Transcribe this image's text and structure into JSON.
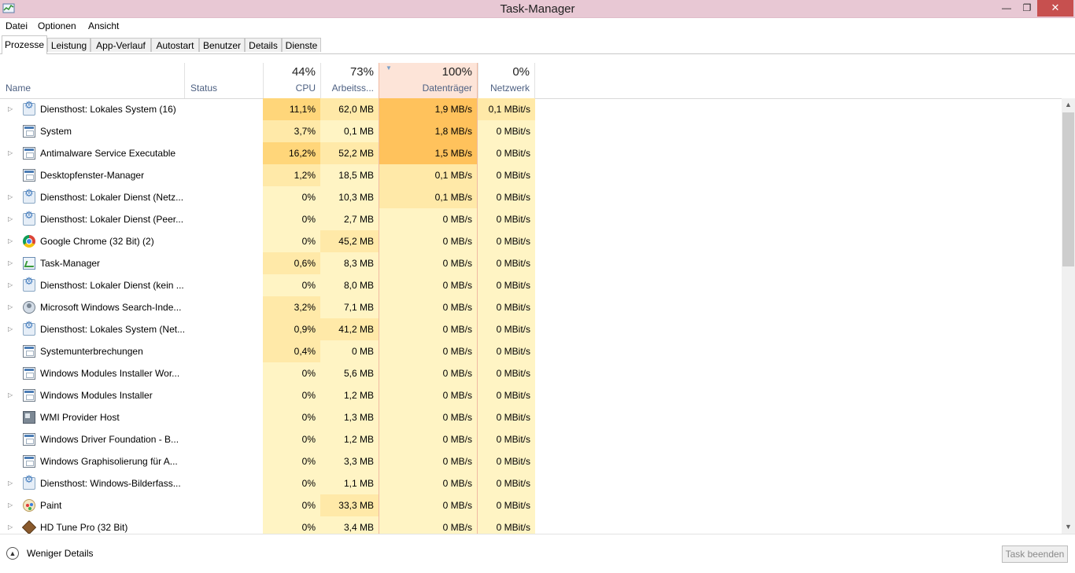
{
  "window": {
    "title": "Task-Manager",
    "minimize": "—",
    "maximize": "❐",
    "close": "✕"
  },
  "menu": [
    "Datei",
    "Optionen",
    "Ansicht"
  ],
  "tabs": [
    {
      "label": "Prozesse",
      "active": true
    },
    {
      "label": "Leistung"
    },
    {
      "label": "App-Verlauf"
    },
    {
      "label": "Autostart"
    },
    {
      "label": "Benutzer"
    },
    {
      "label": "Details"
    },
    {
      "label": "Dienste"
    }
  ],
  "columns": {
    "name": "Name",
    "status": "Status",
    "cpu": {
      "pct": "44%",
      "label": "CPU"
    },
    "mem": {
      "pct": "73%",
      "label": "Arbeitss..."
    },
    "disk": {
      "pct": "100%",
      "label": "Datenträger"
    },
    "net": {
      "pct": "0%",
      "label": "Netzwerk"
    }
  },
  "colors": {
    "heat_low": "#fff4c4",
    "heat_mid": "#ffe9a8",
    "heat_high": "#ffd67a",
    "disk_high": "#ffc25c",
    "sorted_header": "#fde4d8",
    "close_button": "#c7504f",
    "titlebar": "#e8c8d4"
  },
  "processes": [
    {
      "name": "Diensthost: Lokales System (16)",
      "icon": "gear-icon",
      "expandable": true,
      "cpu": "11,1%",
      "mem": "62,0 MB",
      "disk": "1,9 MB/s",
      "net": "0,1 MBit/s",
      "cpu_heat": 3,
      "mem_heat": 2,
      "disk_heat": 4,
      "net_heat": 2
    },
    {
      "name": "System",
      "icon": "window-icon",
      "expandable": false,
      "cpu": "3,7%",
      "mem": "0,1 MB",
      "disk": "1,8 MB/s",
      "net": "0 MBit/s",
      "cpu_heat": 2,
      "mem_heat": 1,
      "disk_heat": 4,
      "net_heat": 1
    },
    {
      "name": "Antimalware Service Executable",
      "icon": "window-icon",
      "expandable": true,
      "cpu": "16,2%",
      "mem": "52,2 MB",
      "disk": "1,5 MB/s",
      "net": "0 MBit/s",
      "cpu_heat": 3,
      "mem_heat": 2,
      "disk_heat": 4,
      "net_heat": 1
    },
    {
      "name": "Desktopfenster-Manager",
      "icon": "window-icon",
      "expandable": false,
      "cpu": "1,2%",
      "mem": "18,5 MB",
      "disk": "0,1 MB/s",
      "net": "0 MBit/s",
      "cpu_heat": 2,
      "mem_heat": 1,
      "disk_heat": 2,
      "net_heat": 1
    },
    {
      "name": "Diensthost: Lokaler Dienst (Netz...",
      "icon": "gear-icon",
      "expandable": true,
      "cpu": "0%",
      "mem": "10,3 MB",
      "disk": "0,1 MB/s",
      "net": "0 MBit/s",
      "cpu_heat": 1,
      "mem_heat": 1,
      "disk_heat": 2,
      "net_heat": 1
    },
    {
      "name": "Diensthost: Lokaler Dienst (Peer...",
      "icon": "gear-icon",
      "expandable": true,
      "cpu": "0%",
      "mem": "2,7 MB",
      "disk": "0 MB/s",
      "net": "0 MBit/s",
      "cpu_heat": 1,
      "mem_heat": 1,
      "disk_heat": 1,
      "net_heat": 1
    },
    {
      "name": "Google Chrome (32 Bit) (2)",
      "icon": "chrome-icon",
      "expandable": true,
      "cpu": "0%",
      "mem": "45,2 MB",
      "disk": "0 MB/s",
      "net": "0 MBit/s",
      "cpu_heat": 1,
      "mem_heat": 2,
      "disk_heat": 1,
      "net_heat": 1
    },
    {
      "name": "Task-Manager",
      "icon": "task-manager-icon",
      "expandable": true,
      "cpu": "0,6%",
      "mem": "8,3 MB",
      "disk": "0 MB/s",
      "net": "0 MBit/s",
      "cpu_heat": 2,
      "mem_heat": 1,
      "disk_heat": 1,
      "net_heat": 1
    },
    {
      "name": "Diensthost: Lokaler Dienst (kein ...",
      "icon": "gear-icon",
      "expandable": true,
      "cpu": "0%",
      "mem": "8,0 MB",
      "disk": "0 MB/s",
      "net": "0 MBit/s",
      "cpu_heat": 1,
      "mem_heat": 1,
      "disk_heat": 1,
      "net_heat": 1
    },
    {
      "name": "Microsoft Windows Search-Inde...",
      "icon": "search-indexer-icon",
      "expandable": true,
      "cpu": "3,2%",
      "mem": "7,1 MB",
      "disk": "0 MB/s",
      "net": "0 MBit/s",
      "cpu_heat": 2,
      "mem_heat": 1,
      "disk_heat": 1,
      "net_heat": 1
    },
    {
      "name": "Diensthost: Lokales System (Net...",
      "icon": "gear-icon",
      "expandable": true,
      "cpu": "0,9%",
      "mem": "41,2 MB",
      "disk": "0 MB/s",
      "net": "0 MBit/s",
      "cpu_heat": 2,
      "mem_heat": 2,
      "disk_heat": 1,
      "net_heat": 1
    },
    {
      "name": "Systemunterbrechungen",
      "icon": "window-icon",
      "expandable": false,
      "cpu": "0,4%",
      "mem": "0 MB",
      "disk": "0 MB/s",
      "net": "0 MBit/s",
      "cpu_heat": 2,
      "mem_heat": 1,
      "disk_heat": 1,
      "net_heat": 1
    },
    {
      "name": "Windows Modules Installer Wor...",
      "icon": "window-icon",
      "expandable": false,
      "cpu": "0%",
      "mem": "5,6 MB",
      "disk": "0 MB/s",
      "net": "0 MBit/s",
      "cpu_heat": 1,
      "mem_heat": 1,
      "disk_heat": 1,
      "net_heat": 1
    },
    {
      "name": "Windows Modules Installer",
      "icon": "window-icon",
      "expandable": true,
      "cpu": "0%",
      "mem": "1,2 MB",
      "disk": "0 MB/s",
      "net": "0 MBit/s",
      "cpu_heat": 1,
      "mem_heat": 1,
      "disk_heat": 1,
      "net_heat": 1
    },
    {
      "name": "WMI Provider Host",
      "icon": "wmi-icon",
      "expandable": false,
      "cpu": "0%",
      "mem": "1,3 MB",
      "disk": "0 MB/s",
      "net": "0 MBit/s",
      "cpu_heat": 1,
      "mem_heat": 1,
      "disk_heat": 1,
      "net_heat": 1
    },
    {
      "name": "Windows Driver Foundation - B...",
      "icon": "window-icon",
      "expandable": false,
      "cpu": "0%",
      "mem": "1,2 MB",
      "disk": "0 MB/s",
      "net": "0 MBit/s",
      "cpu_heat": 1,
      "mem_heat": 1,
      "disk_heat": 1,
      "net_heat": 1
    },
    {
      "name": "Windows Graphisolierung für A...",
      "icon": "window-icon",
      "expandable": false,
      "cpu": "0%",
      "mem": "3,3 MB",
      "disk": "0 MB/s",
      "net": "0 MBit/s",
      "cpu_heat": 1,
      "mem_heat": 1,
      "disk_heat": 1,
      "net_heat": 1
    },
    {
      "name": "Diensthost: Windows-Bilderfass...",
      "icon": "gear-icon",
      "expandable": true,
      "cpu": "0%",
      "mem": "1,1 MB",
      "disk": "0 MB/s",
      "net": "0 MBit/s",
      "cpu_heat": 1,
      "mem_heat": 1,
      "disk_heat": 1,
      "net_heat": 1
    },
    {
      "name": "Paint",
      "icon": "paint-icon",
      "expandable": true,
      "cpu": "0%",
      "mem": "33,3 MB",
      "disk": "0 MB/s",
      "net": "0 MBit/s",
      "cpu_heat": 1,
      "mem_heat": 2,
      "disk_heat": 1,
      "net_heat": 1
    },
    {
      "name": "HD Tune Pro (32 Bit)",
      "icon": "hdtune-icon",
      "expandable": true,
      "cpu": "0%",
      "mem": "3,4 MB",
      "disk": "0 MB/s",
      "net": "0 MBit/s",
      "cpu_heat": 1,
      "mem_heat": 1,
      "disk_heat": 1,
      "net_heat": 1
    }
  ],
  "footer": {
    "fewer_details": "Weniger Details",
    "end_task": "Task beenden"
  }
}
